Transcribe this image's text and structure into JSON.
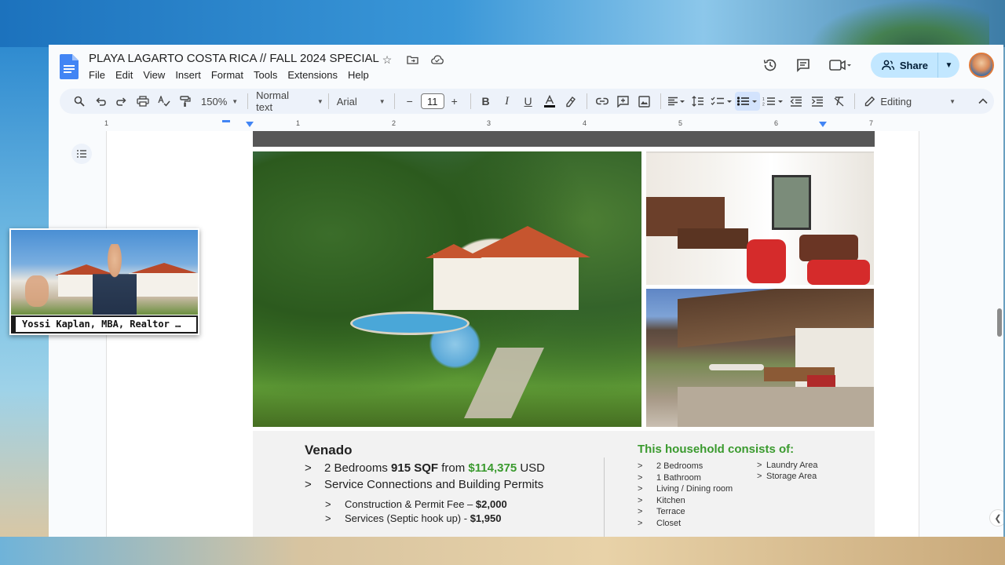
{
  "document": {
    "title": "PLAYA LAGARTO COSTA RICA // FALL 2024 SPECIAL"
  },
  "menu": [
    "File",
    "Edit",
    "View",
    "Insert",
    "Format",
    "Tools",
    "Extensions",
    "Help"
  ],
  "header": {
    "share_label": "Share"
  },
  "toolbar": {
    "zoom": "150%",
    "style": "Normal text",
    "font": "Arial",
    "font_size": "11",
    "mode": "Editing"
  },
  "ruler": {
    "numbers": [
      "1",
      "1",
      "2",
      "3",
      "4",
      "5",
      "6",
      "7"
    ]
  },
  "content": {
    "venado": {
      "title": "Venado",
      "line1_prefix": "2 Bedrooms",
      "line1_sqf": "915 SQF",
      "line1_from": "from",
      "line1_price": "$114,375",
      "line1_currency": "USD",
      "line2": "Service Connections and Building Permits",
      "sub1_text": "Construction & Permit Fee –",
      "sub1_price": "$2,000",
      "sub2_text": "Services (Septic hook up) -",
      "sub2_price": "$1,950"
    },
    "household": {
      "title": "This household consists of:",
      "col1": [
        "2 Bedrooms",
        "1 Bathroom",
        "Living / Dining room",
        "Kitchen",
        "Terrace",
        "Closet"
      ],
      "col2": [
        "Laundry Area",
        "Storage Area"
      ]
    },
    "bullet_char": ">"
  },
  "webcam": {
    "label": "Yossi Kaplan, MBA, Realtor …"
  },
  "colors": {
    "accent_green": "#3a9a2e",
    "share_bg": "#c2e7ff",
    "toolbar_bg": "#edf2fa"
  }
}
